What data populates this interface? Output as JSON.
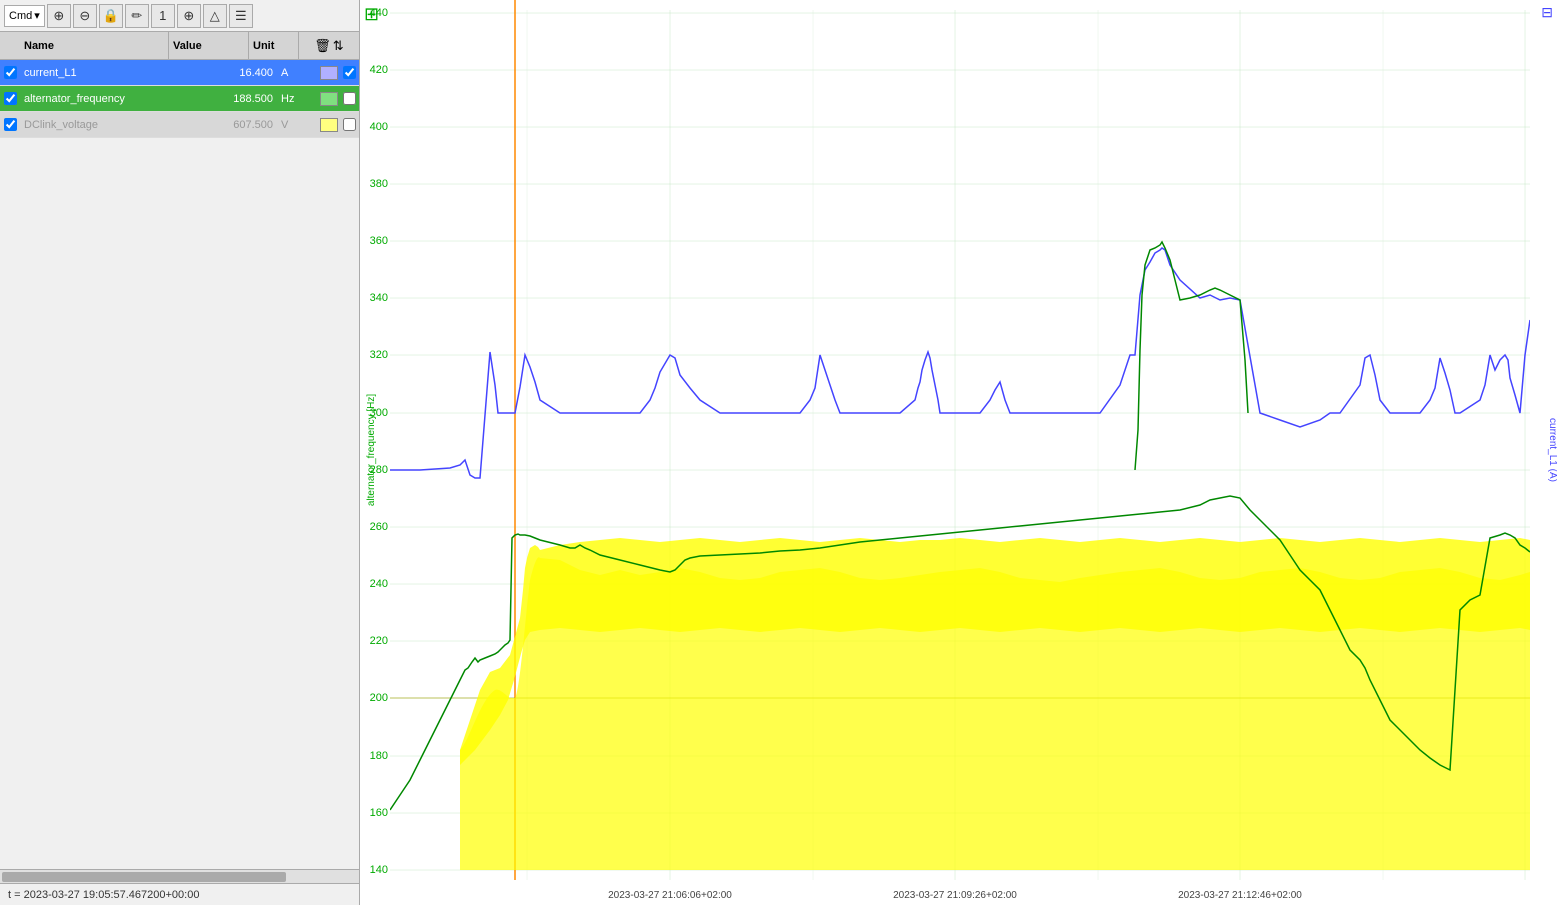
{
  "toolbar": {
    "cmd_label": "Cmd",
    "dropdown_arrow": "▾",
    "buttons": [
      "⊕",
      "⊖",
      "🔒",
      "✏",
      "1",
      "⊕",
      "△",
      "☰"
    ]
  },
  "table": {
    "columns": {
      "name": "Name",
      "value": "Value",
      "unit": "Unit"
    },
    "rows": [
      {
        "id": "current_L1",
        "name": "current_L1",
        "value": "16.400",
        "unit": "A",
        "checked": true,
        "row_class": "row-blue",
        "color_box": "#0000ff"
      },
      {
        "id": "alternator_frequency",
        "name": "alternator_frequency",
        "value": "188.500",
        "unit": "Hz",
        "checked": true,
        "row_class": "row-green",
        "color_box": "#00cc00"
      },
      {
        "id": "DClink_voltage",
        "name": "DClink_voltage",
        "value": "607.500",
        "unit": "V",
        "checked": true,
        "row_class": "row-yellow",
        "color_box": "#ffff00"
      }
    ]
  },
  "status_bar": {
    "time_label": "t = 2023-03-27 19:05:57.467200+00:00"
  },
  "chart": {
    "y_axis_left_label": "alternator_frequency [Hz]",
    "y_axis_right_label": "current_L1 (A)",
    "x_ticks": [
      "2023-03-27 21:06:06+02:00",
      "2023-03-27 21:09:26+02:00",
      "2023-03-27 21:12:46+02:00"
    ],
    "y_ticks": [
      140,
      160,
      180,
      200,
      220,
      240,
      260,
      280,
      300,
      320,
      340,
      360,
      380,
      400,
      420,
      440
    ],
    "corner_icon": "⊞",
    "corner_icon_right": "⊟"
  }
}
